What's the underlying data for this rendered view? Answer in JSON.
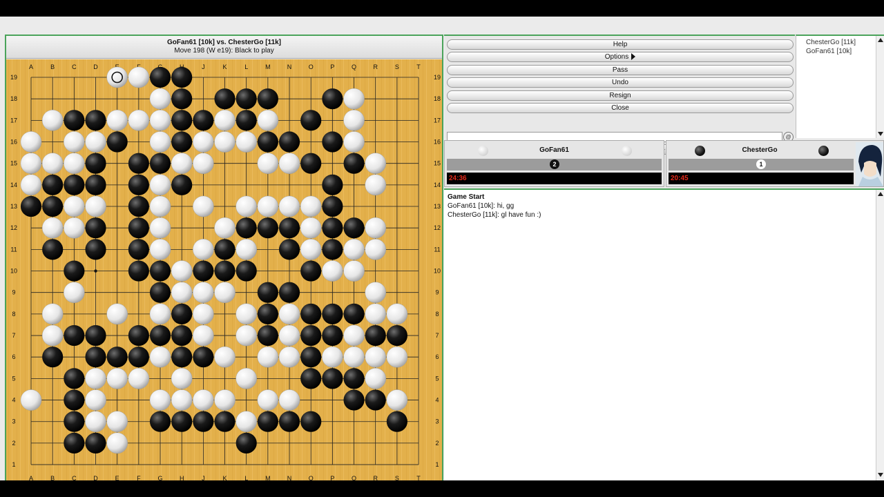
{
  "board": {
    "title": "GoFan61 [10k] vs. ChesterGo [11k]",
    "status": "Move 198 (W e19): Black to play",
    "columns": [
      "A",
      "B",
      "C",
      "D",
      "E",
      "F",
      "G",
      "H",
      "J",
      "K",
      "L",
      "M",
      "N",
      "O",
      "P",
      "Q",
      "R",
      "S",
      "T"
    ],
    "rows": [
      "19",
      "18",
      "17",
      "16",
      "15",
      "14",
      "13",
      "12",
      "11",
      "10",
      "9",
      "8",
      "7",
      "6",
      "5",
      "4",
      "3",
      "2",
      "1"
    ],
    "grid_rows": [
      "....oWBB...........",
      "......WB.BBB...BW..",
      ".WBBWWWBBWBW..B.W..",
      "W.WWBWWBWWWBBW.BW..",
      "WWWB.BBWW..WWB.BW..",
      "WBBB.BWB.......B.W.",
      "BBWW.BW..W.WWWWB...",
      ".WWB.BW..WBBBWBBW..",
      ".B.B.BW..WBW.BWBW..",
      "...B.BBWBBB...BWW..",
      "..W...BWWW..BB...W.",
      ".W...W.WBW.WBWBBB..",
      ".WBB.BBBW..WBWBBWBB.",
      ".B.BBBWWBB.WW.B.WW.",
      "...BWWW.W..W......BBBW.",
      "W..BW..WWWW..WW.BBBW",
      "...BWW.BBBBWBBB..B.",
      "...BBW.....B.......",
      "..................."
    ],
    "stones_black": [
      "G19",
      "H19",
      "H18",
      "K18",
      "L18",
      "M18",
      "P18",
      "C17",
      "D17",
      "H17",
      "J17",
      "L17",
      "O17",
      "E16",
      "H16",
      "M16",
      "N16",
      "P16",
      "D15",
      "F15",
      "G15",
      "O15",
      "Q15",
      "B14",
      "C14",
      "D14",
      "F14",
      "H14",
      "P14",
      "A13",
      "B13",
      "F13",
      "P13",
      "D12",
      "F12",
      "L12",
      "M12",
      "N12",
      "P12",
      "Q12",
      "B11",
      "D11",
      "F11",
      "K11",
      "N11",
      "P11",
      "C10",
      "F10",
      "G10",
      "J10",
      "K10",
      "L10",
      "O10",
      "G9",
      "M9",
      "N9",
      "H8",
      "M8",
      "O8",
      "P8",
      "Q8",
      "C7",
      "D7",
      "F7",
      "G7",
      "H7",
      "M7",
      "O7",
      "P7",
      "R7",
      "S7",
      "B6",
      "D6",
      "E6",
      "F6",
      "H6",
      "J6",
      "O6",
      "C5",
      "O5",
      "P5",
      "Q5",
      "C4",
      "Q4",
      "R4",
      "C3",
      "G3",
      "H3",
      "J3",
      "K3",
      "M3",
      "N3",
      "O3",
      "S3",
      "C2",
      "D2",
      "L2"
    ],
    "stones_white": [
      "E19",
      "F19",
      "G18",
      "Q18",
      "B17",
      "E17",
      "F17",
      "G17",
      "K17",
      "M17",
      "Q17",
      "A16",
      "C16",
      "D16",
      "G16",
      "J16",
      "K16",
      "L16",
      "Q16",
      "A15",
      "B15",
      "C15",
      "H15",
      "J15",
      "M15",
      "N15",
      "R15",
      "A14",
      "G14",
      "R14",
      "C13",
      "D13",
      "G13",
      "J13",
      "L13",
      "M13",
      "N13",
      "O13",
      "B12",
      "C12",
      "G12",
      "K12",
      "O12",
      "R12",
      "G11",
      "J11",
      "L11",
      "O11",
      "Q11",
      "R11",
      "H10",
      "P10",
      "Q10",
      "C9",
      "H9",
      "J9",
      "K9",
      "R9",
      "B8",
      "E8",
      "G8",
      "J8",
      "L8",
      "N8",
      "R8",
      "S8",
      "B7",
      "J7",
      "L7",
      "N7",
      "Q7",
      "G6",
      "K6",
      "M6",
      "N6",
      "P6",
      "Q6",
      "R6",
      "S6",
      "D5",
      "E5",
      "F5",
      "H5",
      "L5",
      "R5",
      "A4",
      "D4",
      "G4",
      "H4",
      "J4",
      "K4",
      "M4",
      "N4",
      "S4",
      "D3",
      "E3",
      "L3",
      "E2"
    ],
    "last_move": "E19"
  },
  "controls": {
    "help": "Help",
    "options": "Options",
    "pass": "Pass",
    "undo": "Undo",
    "resign": "Resign",
    "close": "Close",
    "chat_input_value": ""
  },
  "player_list": [
    "ChesterGo [11k]",
    "GoFan61 [10k]"
  ],
  "players": {
    "white": {
      "name": "GoFan61",
      "captures": "2",
      "time": "24:36"
    },
    "black": {
      "name": "ChesterGo",
      "captures": "1",
      "time": "20:45"
    }
  },
  "chat": {
    "header": "Game Start",
    "lines": [
      "GoFan61 [10k]: hi, gg",
      "ChesterGo [11k]: gl have fun :)"
    ]
  },
  "colors": {
    "board_wood": "#e3b04b",
    "accent_green": "#4aa35a",
    "clock_red": "#e52a1b"
  }
}
